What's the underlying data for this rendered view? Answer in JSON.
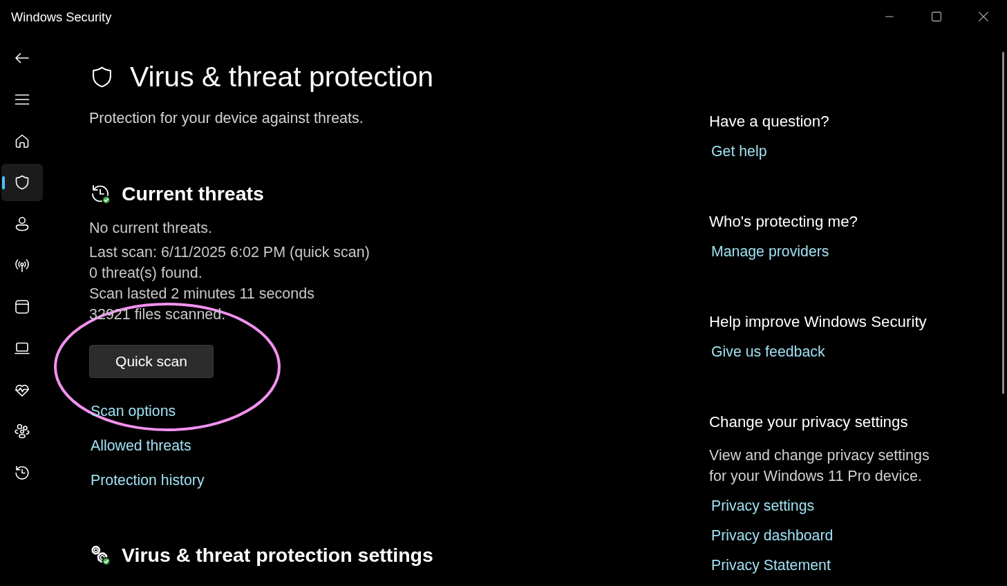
{
  "window": {
    "title": "Windows Security"
  },
  "sidebar": {
    "nav_items": [
      {
        "selected": false
      },
      {
        "selected": true
      },
      {
        "selected": false
      },
      {
        "selected": false
      },
      {
        "selected": false
      },
      {
        "selected": false
      },
      {
        "selected": false
      },
      {
        "selected": false
      },
      {
        "selected": false
      }
    ]
  },
  "page": {
    "title": "Virus & threat protection",
    "subtitle": "Protection for your device against threats."
  },
  "current_threats": {
    "heading": "Current threats",
    "status": "No current threats.",
    "details": [
      "Last scan: 6/11/2025 6:02 PM (quick scan)",
      "0 threat(s) found.",
      "Scan lasted 2 minutes 11 seconds",
      "32921 files scanned."
    ],
    "button": "Quick scan",
    "links": [
      "Scan options",
      "Allowed threats",
      "Protection history"
    ]
  },
  "settings_section": {
    "heading": "Virus & threat protection settings"
  },
  "side_panel": {
    "sections": [
      {
        "heading": "Have a question?",
        "links": [
          "Get help"
        ]
      },
      {
        "heading": "Who's protecting me?",
        "links": [
          "Manage providers"
        ]
      },
      {
        "heading": "Help improve Windows Security",
        "links": [
          "Give us feedback"
        ]
      },
      {
        "heading": "Change your privacy settings",
        "description": "View and change privacy settings for your Windows 11 Pro device.",
        "links": [
          "Privacy settings",
          "Privacy dashboard",
          "Privacy Statement"
        ]
      }
    ]
  }
}
